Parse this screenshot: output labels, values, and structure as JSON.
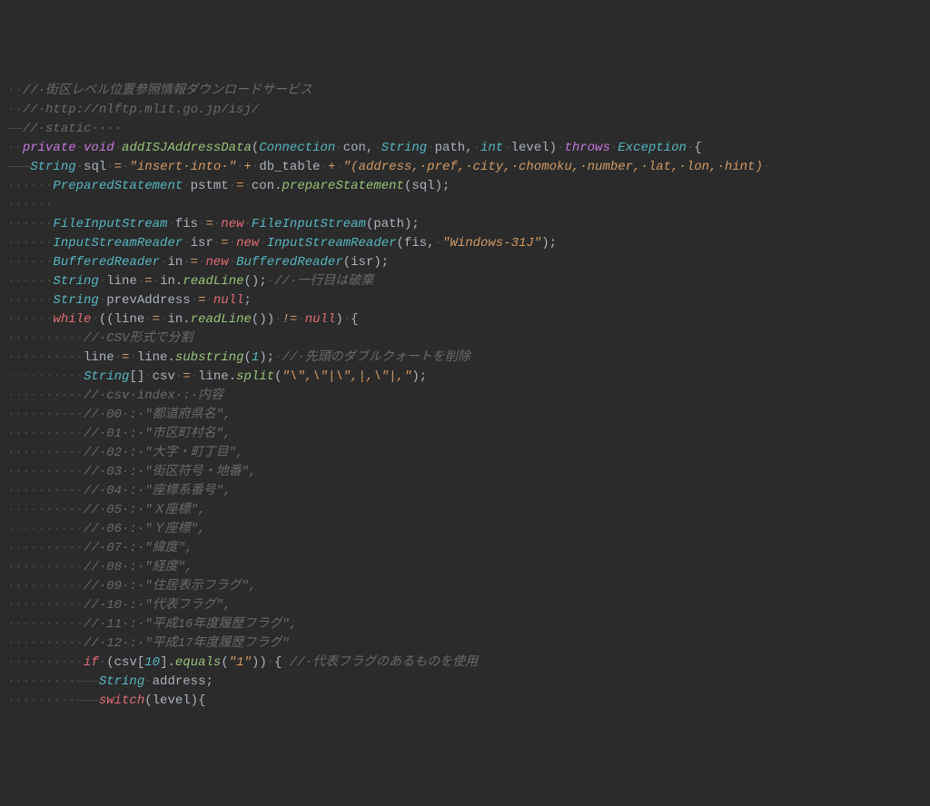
{
  "lines": [
    {
      "id": 1,
      "tokens": [
        {
          "cls": "ws",
          "t": "··"
        },
        {
          "cls": "comment",
          "t": "//·街区レベル位置参照情報ダウンロードサービス"
        }
      ]
    },
    {
      "id": 2,
      "tokens": [
        {
          "cls": "ws",
          "t": "··"
        },
        {
          "cls": "comment",
          "t": "//·http://nlftp.mlit.go.jp/isj/"
        }
      ]
    },
    {
      "id": 3,
      "tokens": [
        {
          "cls": "ws",
          "t": "——"
        },
        {
          "cls": "comment",
          "t": "//·static····"
        }
      ]
    },
    {
      "id": 4,
      "tokens": [
        {
          "cls": "ws",
          "t": "··"
        },
        {
          "cls": "keyword",
          "t": "private"
        },
        {
          "cls": "ws",
          "t": "·"
        },
        {
          "cls": "keyword",
          "t": "void"
        },
        {
          "cls": "ws",
          "t": "·"
        },
        {
          "cls": "method",
          "t": "addISJAddressData"
        },
        {
          "cls": "punc",
          "t": "("
        },
        {
          "cls": "type",
          "t": "Connection"
        },
        {
          "cls": "ws",
          "t": "·"
        },
        {
          "cls": "varname",
          "t": "con"
        },
        {
          "cls": "punc",
          "t": ","
        },
        {
          "cls": "ws",
          "t": "·"
        },
        {
          "cls": "type",
          "t": "String"
        },
        {
          "cls": "ws",
          "t": "·"
        },
        {
          "cls": "varname",
          "t": "path"
        },
        {
          "cls": "punc",
          "t": ","
        },
        {
          "cls": "ws",
          "t": "·"
        },
        {
          "cls": "type",
          "t": "int"
        },
        {
          "cls": "ws",
          "t": "·"
        },
        {
          "cls": "varname",
          "t": "level"
        },
        {
          "cls": "punc",
          "t": ")"
        },
        {
          "cls": "ws",
          "t": "·"
        },
        {
          "cls": "keyword",
          "t": "throws"
        },
        {
          "cls": "ws",
          "t": "·"
        },
        {
          "cls": "type",
          "t": "Exception"
        },
        {
          "cls": "ws",
          "t": "·"
        },
        {
          "cls": "punc",
          "t": "{"
        }
      ]
    },
    {
      "id": 5,
      "tokens": [
        {
          "cls": "ws",
          "t": ""
        }
      ]
    },
    {
      "id": 6,
      "tokens": [
        {
          "cls": "ws",
          "t": "———"
        },
        {
          "cls": "type",
          "t": "String"
        },
        {
          "cls": "ws",
          "t": "·"
        },
        {
          "cls": "varname",
          "t": "sql"
        },
        {
          "cls": "ws",
          "t": "·"
        },
        {
          "cls": "op",
          "t": "="
        },
        {
          "cls": "ws",
          "t": "·"
        },
        {
          "cls": "string",
          "t": "\"insert·into·\""
        },
        {
          "cls": "ws",
          "t": "·"
        },
        {
          "cls": "op",
          "t": "+"
        },
        {
          "cls": "ws",
          "t": "·"
        },
        {
          "cls": "varname",
          "t": "db_table"
        },
        {
          "cls": "ws",
          "t": "·"
        },
        {
          "cls": "op",
          "t": "+"
        },
        {
          "cls": "ws",
          "t": "·"
        },
        {
          "cls": "string",
          "t": "\"(address,·pref,·city,·chomoku,·number,·lat,·lon,·hint)"
        },
        {
          "cls": "ws",
          "t": "·"
        }
      ]
    },
    {
      "id": 7,
      "tokens": [
        {
          "cls": "ws",
          "t": "······"
        },
        {
          "cls": "type",
          "t": "PreparedStatement"
        },
        {
          "cls": "ws",
          "t": "·"
        },
        {
          "cls": "varname",
          "t": "pstmt"
        },
        {
          "cls": "ws",
          "t": "·"
        },
        {
          "cls": "op",
          "t": "="
        },
        {
          "cls": "ws",
          "t": "·"
        },
        {
          "cls": "varname",
          "t": "con"
        },
        {
          "cls": "punc",
          "t": "."
        },
        {
          "cls": "method",
          "t": "prepareStatement"
        },
        {
          "cls": "punc",
          "t": "("
        },
        {
          "cls": "varname",
          "t": "sql"
        },
        {
          "cls": "punc",
          "t": ");"
        }
      ]
    },
    {
      "id": 8,
      "tokens": [
        {
          "cls": "ws",
          "t": "······"
        }
      ]
    },
    {
      "id": 9,
      "tokens": [
        {
          "cls": "ws",
          "t": "······"
        },
        {
          "cls": "type",
          "t": "FileInputStream"
        },
        {
          "cls": "ws",
          "t": "·"
        },
        {
          "cls": "varname",
          "t": "fis"
        },
        {
          "cls": "ws",
          "t": "·"
        },
        {
          "cls": "op",
          "t": "="
        },
        {
          "cls": "ws",
          "t": "·"
        },
        {
          "cls": "kw2",
          "t": "new"
        },
        {
          "cls": "ws",
          "t": "·"
        },
        {
          "cls": "type",
          "t": "FileInputStream"
        },
        {
          "cls": "punc",
          "t": "("
        },
        {
          "cls": "varname",
          "t": "path"
        },
        {
          "cls": "punc",
          "t": ");"
        }
      ]
    },
    {
      "id": 10,
      "tokens": [
        {
          "cls": "ws",
          "t": "······"
        },
        {
          "cls": "type",
          "t": "InputStreamReader"
        },
        {
          "cls": "ws",
          "t": "·"
        },
        {
          "cls": "varname",
          "t": "isr"
        },
        {
          "cls": "ws",
          "t": "·"
        },
        {
          "cls": "op",
          "t": "="
        },
        {
          "cls": "ws",
          "t": "·"
        },
        {
          "cls": "kw2",
          "t": "new"
        },
        {
          "cls": "ws",
          "t": "·"
        },
        {
          "cls": "type",
          "t": "InputStreamReader"
        },
        {
          "cls": "punc",
          "t": "("
        },
        {
          "cls": "varname",
          "t": "fis"
        },
        {
          "cls": "punc",
          "t": ","
        },
        {
          "cls": "ws",
          "t": "·"
        },
        {
          "cls": "string",
          "t": "\"Windows-31J\""
        },
        {
          "cls": "punc",
          "t": ");"
        }
      ]
    },
    {
      "id": 11,
      "tokens": [
        {
          "cls": "ws",
          "t": "······"
        },
        {
          "cls": "type",
          "t": "BufferedReader"
        },
        {
          "cls": "ws",
          "t": "·"
        },
        {
          "cls": "varname",
          "t": "in"
        },
        {
          "cls": "ws",
          "t": "·"
        },
        {
          "cls": "op",
          "t": "="
        },
        {
          "cls": "ws",
          "t": "·"
        },
        {
          "cls": "kw2",
          "t": "new"
        },
        {
          "cls": "ws",
          "t": "·"
        },
        {
          "cls": "type",
          "t": "BufferedReader"
        },
        {
          "cls": "punc",
          "t": "("
        },
        {
          "cls": "varname",
          "t": "isr"
        },
        {
          "cls": "punc",
          "t": ");"
        }
      ]
    },
    {
      "id": 12,
      "tokens": [
        {
          "cls": "ws",
          "t": "······"
        },
        {
          "cls": "type",
          "t": "String"
        },
        {
          "cls": "ws",
          "t": "·"
        },
        {
          "cls": "varname",
          "t": "line"
        },
        {
          "cls": "ws",
          "t": "·"
        },
        {
          "cls": "op",
          "t": "="
        },
        {
          "cls": "ws",
          "t": "·"
        },
        {
          "cls": "varname",
          "t": "in"
        },
        {
          "cls": "punc",
          "t": "."
        },
        {
          "cls": "method",
          "t": "readLine"
        },
        {
          "cls": "punc",
          "t": "();"
        },
        {
          "cls": "ws",
          "t": "·"
        },
        {
          "cls": "comment",
          "t": "//·一行目は破棄"
        }
      ]
    },
    {
      "id": 13,
      "tokens": [
        {
          "cls": "ws",
          "t": "······"
        },
        {
          "cls": "type",
          "t": "String"
        },
        {
          "cls": "ws",
          "t": "·"
        },
        {
          "cls": "varname",
          "t": "prevAddress"
        },
        {
          "cls": "ws",
          "t": "·"
        },
        {
          "cls": "op",
          "t": "="
        },
        {
          "cls": "ws",
          "t": "·"
        },
        {
          "cls": "kw2",
          "t": "null"
        },
        {
          "cls": "punc",
          "t": ";"
        }
      ]
    },
    {
      "id": 14,
      "tokens": [
        {
          "cls": "ws",
          "t": "······"
        },
        {
          "cls": "kw2",
          "t": "while"
        },
        {
          "cls": "ws",
          "t": "·"
        },
        {
          "cls": "punc",
          "t": "(("
        },
        {
          "cls": "varname",
          "t": "line"
        },
        {
          "cls": "ws",
          "t": "·"
        },
        {
          "cls": "op",
          "t": "="
        },
        {
          "cls": "ws",
          "t": "·"
        },
        {
          "cls": "varname",
          "t": "in"
        },
        {
          "cls": "punc",
          "t": "."
        },
        {
          "cls": "method",
          "t": "readLine"
        },
        {
          "cls": "punc",
          "t": "())"
        },
        {
          "cls": "ws",
          "t": "·"
        },
        {
          "cls": "op",
          "t": "!="
        },
        {
          "cls": "ws",
          "t": "·"
        },
        {
          "cls": "kw2",
          "t": "null"
        },
        {
          "cls": "punc",
          "t": ")"
        },
        {
          "cls": "ws",
          "t": "·"
        },
        {
          "cls": "punc",
          "t": "{"
        }
      ]
    },
    {
      "id": 15,
      "tokens": [
        {
          "cls": "ws",
          "t": "··········"
        },
        {
          "cls": "comment",
          "t": "//·CSV形式で分割"
        }
      ]
    },
    {
      "id": 16,
      "tokens": [
        {
          "cls": "ws",
          "t": "··········"
        },
        {
          "cls": "varname",
          "t": "line"
        },
        {
          "cls": "ws",
          "t": "·"
        },
        {
          "cls": "op",
          "t": "="
        },
        {
          "cls": "ws",
          "t": "·"
        },
        {
          "cls": "varname",
          "t": "line"
        },
        {
          "cls": "punc",
          "t": "."
        },
        {
          "cls": "method",
          "t": "substring"
        },
        {
          "cls": "punc",
          "t": "("
        },
        {
          "cls": "num",
          "t": "1"
        },
        {
          "cls": "punc",
          "t": ");"
        },
        {
          "cls": "ws",
          "t": "·"
        },
        {
          "cls": "comment",
          "t": "//·先頭のダブルクォートを削除"
        }
      ]
    },
    {
      "id": 17,
      "tokens": [
        {
          "cls": "ws",
          "t": "··········"
        },
        {
          "cls": "type",
          "t": "String"
        },
        {
          "cls": "punc",
          "t": "[]"
        },
        {
          "cls": "ws",
          "t": "·"
        },
        {
          "cls": "varname",
          "t": "csv"
        },
        {
          "cls": "ws",
          "t": "·"
        },
        {
          "cls": "op",
          "t": "="
        },
        {
          "cls": "ws",
          "t": "·"
        },
        {
          "cls": "varname",
          "t": "line"
        },
        {
          "cls": "punc",
          "t": "."
        },
        {
          "cls": "method",
          "t": "split"
        },
        {
          "cls": "punc",
          "t": "("
        },
        {
          "cls": "string",
          "t": "\"\\\",\\\"|\\\",|,\\\"|,\""
        },
        {
          "cls": "punc",
          "t": ");"
        }
      ]
    },
    {
      "id": 18,
      "tokens": [
        {
          "cls": "ws",
          "t": "··········"
        },
        {
          "cls": "comment",
          "t": "//·csv·index·:·内容"
        }
      ]
    },
    {
      "id": 19,
      "tokens": [
        {
          "cls": "ws",
          "t": "··········"
        },
        {
          "cls": "comment",
          "t": "//·00·:·\"都道府県名\","
        }
      ]
    },
    {
      "id": 20,
      "tokens": [
        {
          "cls": "ws",
          "t": "··········"
        },
        {
          "cls": "comment",
          "t": "//·01·:·\"市区町村名\","
        }
      ]
    },
    {
      "id": 21,
      "tokens": [
        {
          "cls": "ws",
          "t": "··········"
        },
        {
          "cls": "comment",
          "t": "//·02·:·\"大字・町丁目\","
        }
      ]
    },
    {
      "id": 22,
      "tokens": [
        {
          "cls": "ws",
          "t": "··········"
        },
        {
          "cls": "comment",
          "t": "//·03·:·\"街区符号・地番\","
        }
      ]
    },
    {
      "id": 23,
      "tokens": [
        {
          "cls": "ws",
          "t": "··········"
        },
        {
          "cls": "comment",
          "t": "//·04·:·\"座標系番号\","
        }
      ]
    },
    {
      "id": 24,
      "tokens": [
        {
          "cls": "ws",
          "t": "··········"
        },
        {
          "cls": "comment",
          "t": "//·05·:·\"Ｘ座標\","
        }
      ]
    },
    {
      "id": 25,
      "tokens": [
        {
          "cls": "ws",
          "t": "··········"
        },
        {
          "cls": "comment",
          "t": "//·06·:·\"Ｙ座標\","
        }
      ]
    },
    {
      "id": 26,
      "tokens": [
        {
          "cls": "ws",
          "t": "··········"
        },
        {
          "cls": "comment",
          "t": "//·07·:·\"緯度\","
        }
      ]
    },
    {
      "id": 27,
      "tokens": [
        {
          "cls": "ws",
          "t": "··········"
        },
        {
          "cls": "comment",
          "t": "//·08·:·\"経度\","
        }
      ]
    },
    {
      "id": 28,
      "tokens": [
        {
          "cls": "ws",
          "t": "··········"
        },
        {
          "cls": "comment",
          "t": "//·09·:·\"住居表示フラグ\","
        }
      ]
    },
    {
      "id": 29,
      "tokens": [
        {
          "cls": "ws",
          "t": "··········"
        },
        {
          "cls": "comment",
          "t": "//·10·:·\"代表フラグ\","
        }
      ]
    },
    {
      "id": 30,
      "tokens": [
        {
          "cls": "ws",
          "t": "··········"
        },
        {
          "cls": "comment",
          "t": "//·11·:·\"平成16年度履歴フラグ\","
        }
      ]
    },
    {
      "id": 31,
      "tokens": [
        {
          "cls": "ws",
          "t": "··········"
        },
        {
          "cls": "comment",
          "t": "//·12·:·\"平成17年度履歴フラグ\""
        }
      ]
    },
    {
      "id": 32,
      "tokens": [
        {
          "cls": "ws",
          "t": "··········"
        },
        {
          "cls": "kw2",
          "t": "if"
        },
        {
          "cls": "ws",
          "t": "·"
        },
        {
          "cls": "punc",
          "t": "("
        },
        {
          "cls": "varname",
          "t": "csv"
        },
        {
          "cls": "punc",
          "t": "["
        },
        {
          "cls": "num",
          "t": "10"
        },
        {
          "cls": "punc",
          "t": "]."
        },
        {
          "cls": "method",
          "t": "equals"
        },
        {
          "cls": "punc",
          "t": "("
        },
        {
          "cls": "string",
          "t": "\"1\""
        },
        {
          "cls": "punc",
          "t": "))"
        },
        {
          "cls": "ws",
          "t": "·"
        },
        {
          "cls": "punc",
          "t": "{"
        },
        {
          "cls": "ws",
          "t": "·"
        },
        {
          "cls": "comment",
          "t": "//·代表フラグのあるものを使用"
        }
      ]
    },
    {
      "id": 33,
      "tokens": [
        {
          "cls": "ws",
          "t": ""
        }
      ]
    },
    {
      "id": 34,
      "tokens": [
        {
          "cls": "ws",
          "t": "·········———"
        },
        {
          "cls": "type",
          "t": "String"
        },
        {
          "cls": "ws",
          "t": "·"
        },
        {
          "cls": "varname",
          "t": "address"
        },
        {
          "cls": "punc",
          "t": ";"
        }
      ]
    },
    {
      "id": 35,
      "tokens": [
        {
          "cls": "ws",
          "t": "·········———"
        },
        {
          "cls": "kw2",
          "t": "switch"
        },
        {
          "cls": "punc",
          "t": "("
        },
        {
          "cls": "varname",
          "t": "level"
        },
        {
          "cls": "punc",
          "t": "){"
        }
      ]
    }
  ]
}
